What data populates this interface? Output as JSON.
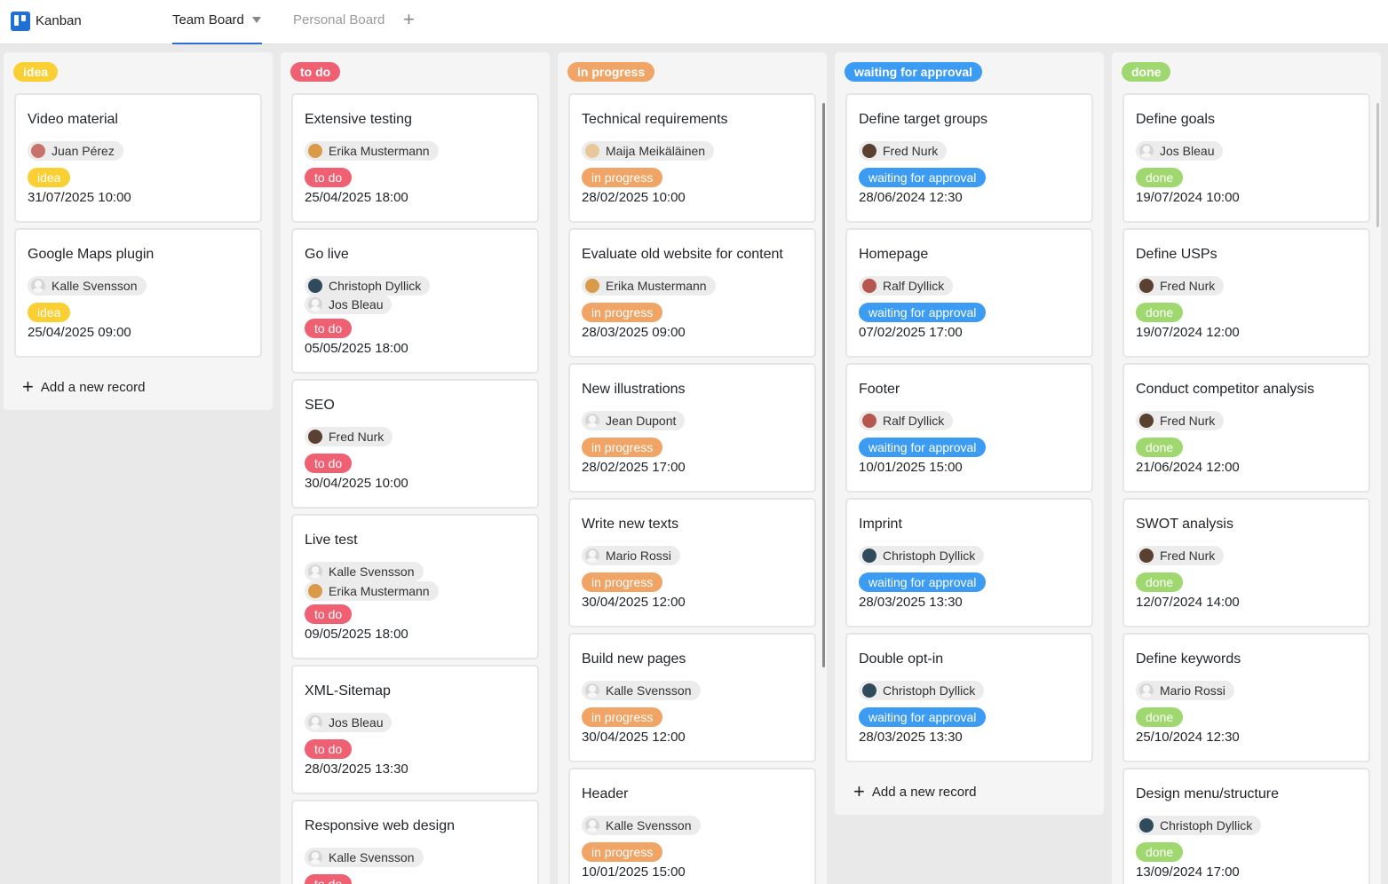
{
  "app": {
    "title": "Kanban"
  },
  "tabs": [
    {
      "label": "Team Board",
      "active": true
    },
    {
      "label": "Personal Board",
      "active": false
    }
  ],
  "add_tab_icon": "plus-icon",
  "add_record_label": "Add a new record",
  "colors": {
    "idea": "#f9cf32",
    "todo": "#ef6073",
    "in_progress": "#f0a465",
    "waiting": "#3c9bf3",
    "done": "#9fd86e"
  },
  "columns": [
    {
      "tag": "idea",
      "cards": [
        {
          "title": "Video material",
          "people": [
            "Juan Pérez"
          ],
          "status": "idea",
          "date": "31/07/2025 10:00"
        },
        {
          "title": "Google Maps plugin",
          "people": [
            "Kalle Svensson"
          ],
          "status": "idea",
          "date": "25/04/2025 09:00"
        }
      ]
    },
    {
      "tag": "to do",
      "cards": [
        {
          "title": "Extensive testing",
          "people": [
            "Erika Mustermann"
          ],
          "status": "to do",
          "date": "25/04/2025 18:00"
        },
        {
          "title": "Go live",
          "people": [
            "Christoph Dyllick",
            "Jos Bleau"
          ],
          "status": "to do",
          "date": "05/05/2025 18:00"
        },
        {
          "title": "SEO",
          "people": [
            "Fred Nurk"
          ],
          "status": "to do",
          "date": "30/04/2025 10:00"
        },
        {
          "title": "Live test",
          "people": [
            "Kalle Svensson",
            "Erika Mustermann"
          ],
          "status": "to do",
          "date": "09/05/2025 18:00"
        },
        {
          "title": "XML-Sitemap",
          "people": [
            "Jos Bleau"
          ],
          "status": "to do",
          "date": "28/03/2025 13:30"
        },
        {
          "title": "Responsive web design",
          "people": [
            "Kalle Svensson"
          ],
          "status": "to do",
          "date": ""
        }
      ]
    },
    {
      "tag": "in progress",
      "cards": [
        {
          "title": "Technical requirements",
          "people": [
            "Maija Meikäläinen"
          ],
          "status": "in progress",
          "date": "28/02/2025 10:00"
        },
        {
          "title": "Evaluate old website for content",
          "people": [
            "Erika Mustermann"
          ],
          "status": "in progress",
          "date": "28/03/2025 09:00"
        },
        {
          "title": "New illustrations",
          "people": [
            "Jean Dupont"
          ],
          "status": "in progress",
          "date": "28/02/2025 17:00"
        },
        {
          "title": "Write new texts",
          "people": [
            "Mario Rossi"
          ],
          "status": "in progress",
          "date": "30/04/2025 12:00"
        },
        {
          "title": "Build new pages",
          "people": [
            "Kalle Svensson"
          ],
          "status": "in progress",
          "date": "30/04/2025 12:00"
        },
        {
          "title": "Header",
          "people": [
            "Kalle Svensson"
          ],
          "status": "in progress",
          "date": "10/01/2025 15:00"
        }
      ]
    },
    {
      "tag": "waiting for approval",
      "cards": [
        {
          "title": "Define target groups",
          "people": [
            "Fred Nurk"
          ],
          "status": "waiting for approval",
          "date": "28/06/2024 12:30"
        },
        {
          "title": "Homepage",
          "people": [
            "Ralf Dyllick"
          ],
          "status": "waiting for approval",
          "date": "07/02/2025 17:00"
        },
        {
          "title": "Footer",
          "people": [
            "Ralf Dyllick"
          ],
          "status": "waiting for approval",
          "date": "10/01/2025 15:00"
        },
        {
          "title": "Imprint",
          "people": [
            "Christoph Dyllick"
          ],
          "status": "waiting for approval",
          "date": "28/03/2025 13:30"
        },
        {
          "title": "Double opt-in",
          "people": [
            "Christoph Dyllick"
          ],
          "status": "waiting for approval",
          "date": "28/03/2025 13:30"
        }
      ]
    },
    {
      "tag": "done",
      "cards": [
        {
          "title": "Define goals",
          "people": [
            "Jos Bleau"
          ],
          "status": "done",
          "date": "19/07/2024 10:00"
        },
        {
          "title": "Define USPs",
          "people": [
            "Fred Nurk"
          ],
          "status": "done",
          "date": "19/07/2024 12:00"
        },
        {
          "title": "Conduct competitor analysis",
          "people": [
            "Fred Nurk"
          ],
          "status": "done",
          "date": "21/06/2024 12:00"
        },
        {
          "title": "SWOT analysis",
          "people": [
            "Fred Nurk"
          ],
          "status": "done",
          "date": "12/07/2024 14:00"
        },
        {
          "title": "Define keywords",
          "people": [
            "Mario Rossi"
          ],
          "status": "done",
          "date": "25/10/2024 12:30"
        },
        {
          "title": "Design menu/structure",
          "people": [
            "Christoph Dyllick"
          ],
          "status": "done",
          "date": "13/09/2024 17:00"
        }
      ]
    }
  ]
}
